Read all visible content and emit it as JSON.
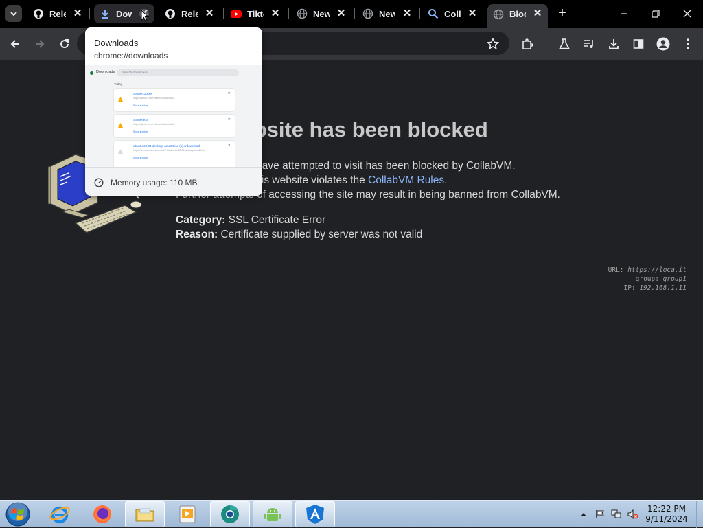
{
  "browser": {
    "tabs": [
      {
        "title": "Release",
        "icon": "github-icon",
        "state": "normal"
      },
      {
        "title": "Downloads",
        "icon": "download-icon",
        "state": "hovered"
      },
      {
        "title": "Release",
        "icon": "github-icon",
        "state": "normal"
      },
      {
        "title": "Tiktok",
        "icon": "youtube-icon",
        "state": "normal"
      },
      {
        "title": "New Tab",
        "icon": "globe-icon",
        "state": "normal"
      },
      {
        "title": "New Tab",
        "icon": "globe-icon",
        "state": "normal"
      },
      {
        "title": "CollabVM",
        "icon": "search-icon",
        "state": "normal"
      },
      {
        "title": "Blocked",
        "icon": "globe-icon",
        "state": "active"
      }
    ],
    "tab_close_glyph": "✕",
    "new_tab_glyph": "+",
    "hovercard": {
      "title": "Downloads",
      "url": "chrome://downloads",
      "memory": "Memory usage: 110 MB",
      "preview": {
        "label": "Downloads",
        "search_placeholder": "Search downloads",
        "section": "Today",
        "items": [
          {
            "name": "SSMM12.exe",
            "src": "https://github.com/releases/download/...",
            "action": "Show in folder"
          },
          {
            "name": "SSMM.exe",
            "src": "https://github.com/releases/download/...",
            "action": "Show in folder"
          },
          {
            "name": "ubuntu-22.04-desktop-amd64.iso (1).crdownload",
            "src": "https://releases.ubuntu.com/22.04/ubuntu-22.04-desktop-amd64.iso",
            "action": "Show in folder"
          }
        ]
      }
    }
  },
  "page": {
    "heading": "This website has been blocked",
    "line1": "The website you have attempted to visit has been blocked by CollabVM.",
    "line2_prefix": "This is because this website violates the ",
    "line2_link": "CollabVM Rules",
    "line2_suffix": ".",
    "line3": "Further attempts of accessing the site may result in being banned from CollabVM.",
    "category_label": "Category:",
    "category_value": " SSL Certificate Error",
    "reason_label": "Reason:",
    "reason_value": " Certificate supplied by server was not valid",
    "meta": {
      "url_label": "URL: ",
      "url_value": "https://loca.it",
      "group_label": "group: ",
      "group_value": "group1",
      "ip_label": "IP: ",
      "ip_value": "192.168.1.11"
    }
  },
  "taskbar": {
    "apps": [
      "internet-explorer-icon",
      "firefox-icon",
      "file-explorer-icon",
      "media-player-icon",
      "chrome-icon",
      "android-studio-icon",
      "angular-icon"
    ],
    "clock_time": "12:22 PM",
    "clock_date": "9/11/2024"
  },
  "colors": {
    "link": "#8ab4f8",
    "page_bg": "#202124",
    "tabstrip_bg": "#000000"
  }
}
